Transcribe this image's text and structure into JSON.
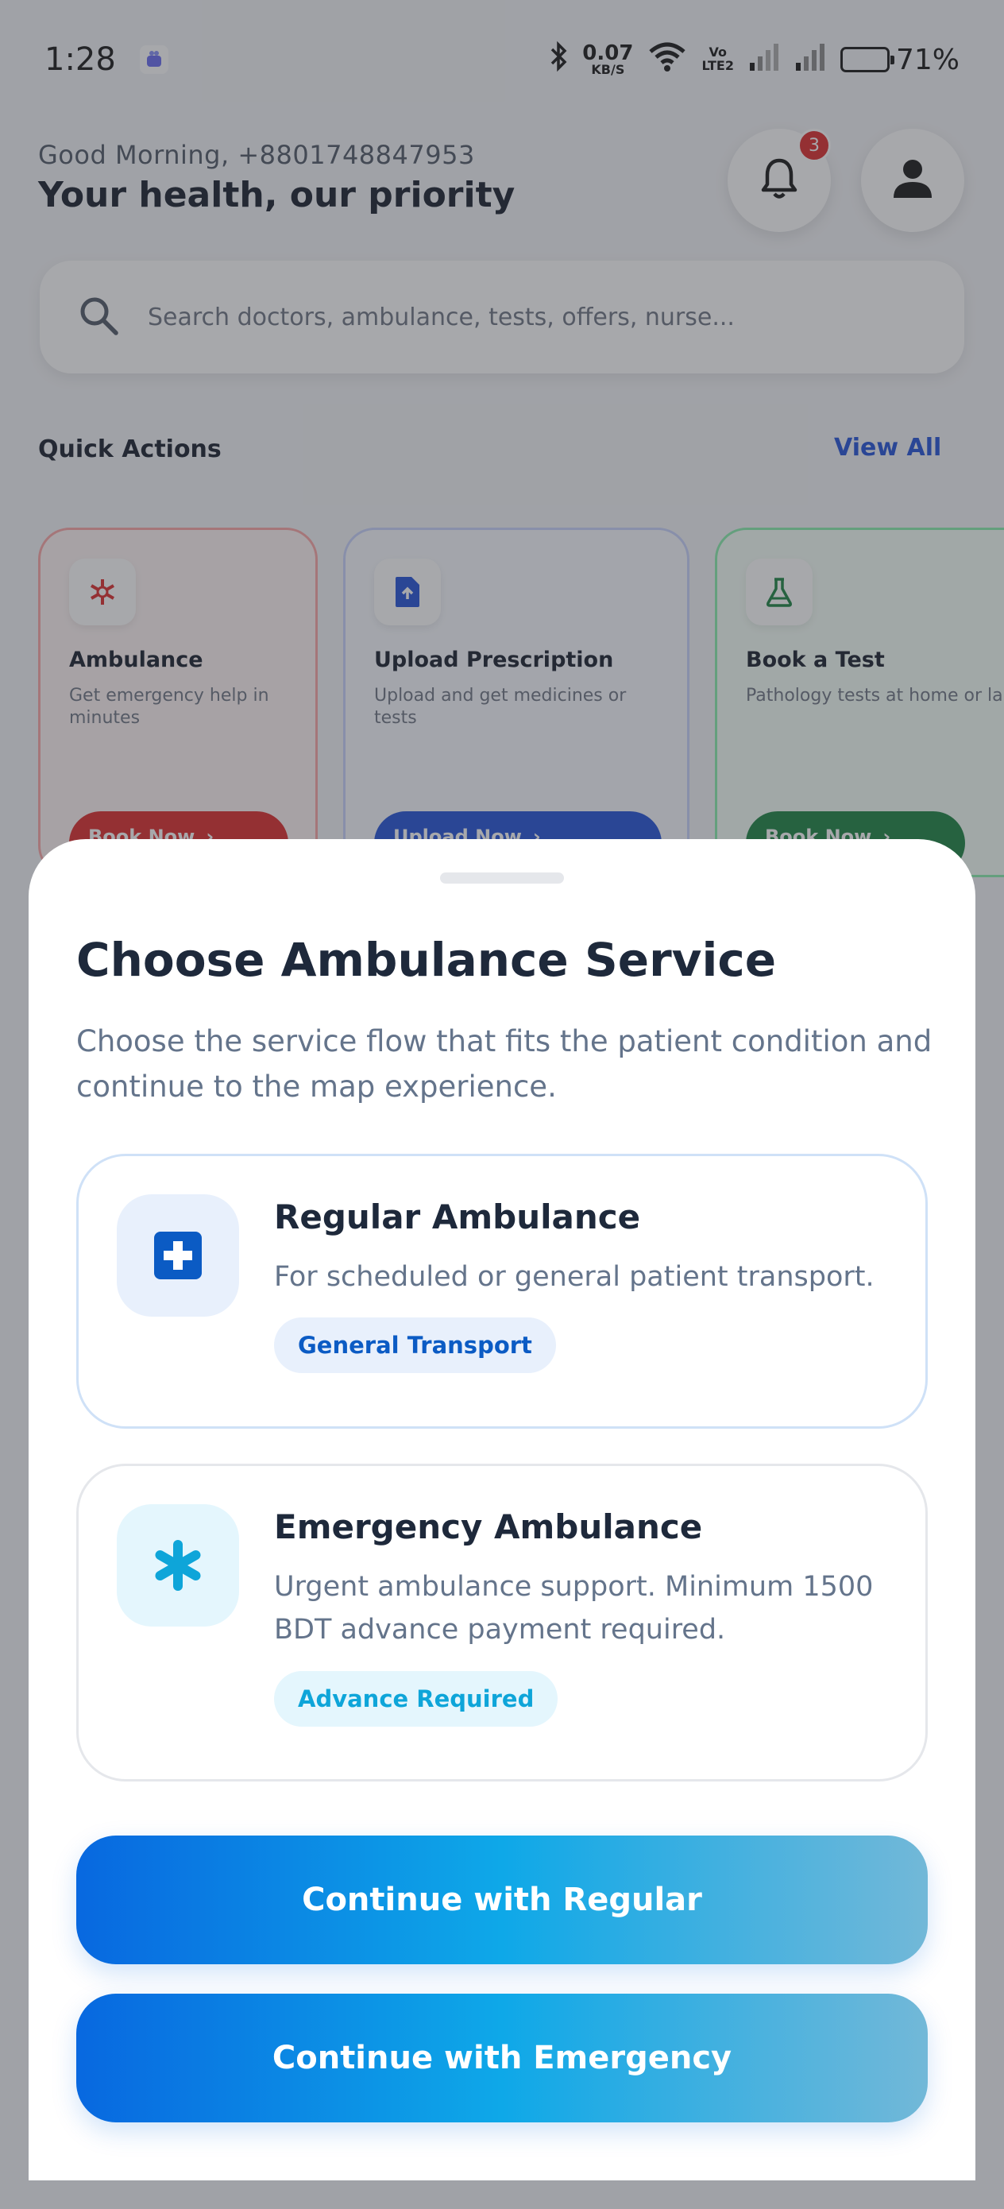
{
  "status_bar": {
    "time": "1:28",
    "net_speed": "0.07",
    "net_unit": "KB/S",
    "volte_top": "Vo",
    "volte_bottom": "LTE2",
    "battery": "71%"
  },
  "header": {
    "greeting": "Good Morning, +8801748847953",
    "tagline": "Your health, our priority",
    "notification_count": "3"
  },
  "search": {
    "placeholder": "Search doctors, ambulance, tests, offers, nurse..."
  },
  "quick_actions": {
    "title": "Quick Actions",
    "view_all": "View All",
    "cards": [
      {
        "title": "Ambulance",
        "desc": "Get emergency help in minutes",
        "button": "Book Now",
        "color": "#dc2626"
      },
      {
        "title": "Upload Prescription",
        "desc": "Upload and get medicines or tests",
        "button": "Upload Now",
        "color": "#1d4ed8"
      },
      {
        "title": "Book a Test",
        "desc": "Pathology tests at home or lab",
        "button": "Book Now",
        "color": "#15803d"
      }
    ]
  },
  "sheet": {
    "title": "Choose Ambulance Service",
    "subtitle": "Choose the service flow that fits the patient condition and continue to the map experience.",
    "options": [
      {
        "title": "Regular Ambulance",
        "desc": "For scheduled or general patient transport.",
        "tag": "General Transport",
        "icon": "medical-cross-icon",
        "color": "#0b5bc4"
      },
      {
        "title": "Emergency Ambulance",
        "desc": "Urgent ambulance support. Minimum 1500 BDT advance payment required.",
        "tag": "Advance Required",
        "icon": "asterisk-icon",
        "color": "#0ea5d9"
      }
    ],
    "continue_regular": "Continue with Regular",
    "continue_emergency": "Continue with Emergency"
  }
}
